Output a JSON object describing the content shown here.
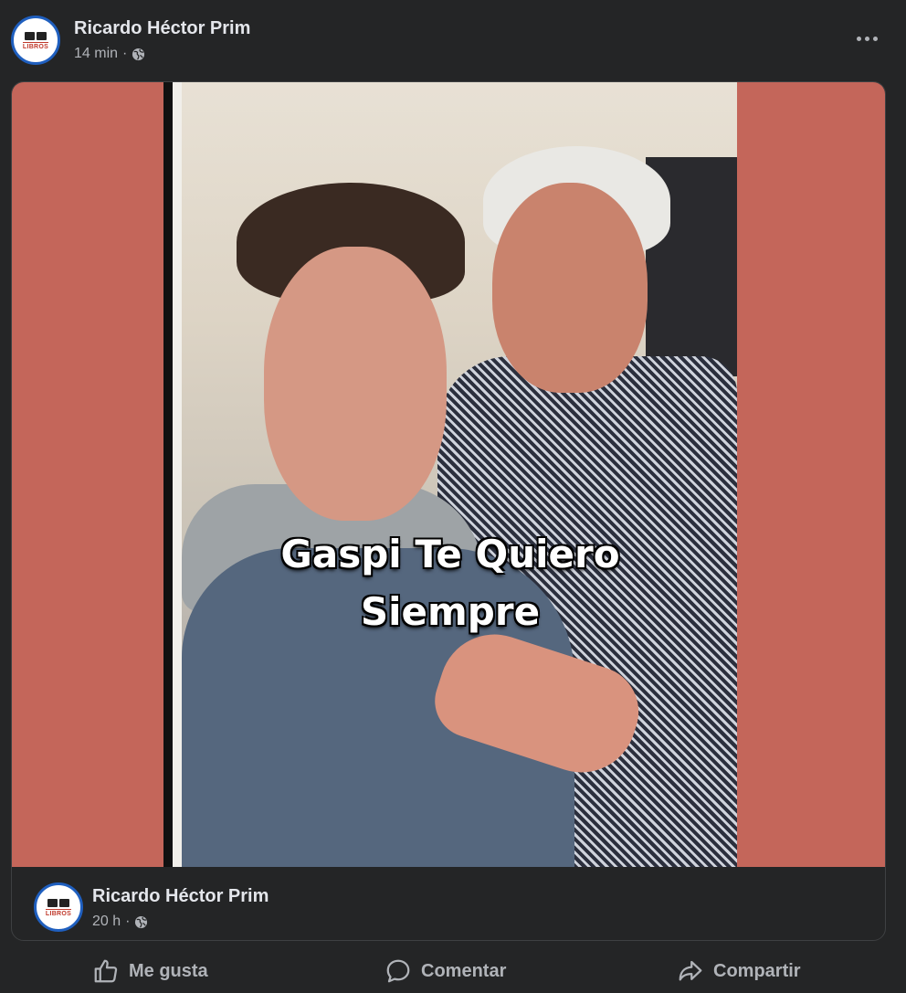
{
  "post": {
    "author": "Ricardo Héctor Prim",
    "time": "14 min",
    "separator": "·",
    "avatar_word": "LIBROS"
  },
  "shared_post": {
    "caption_line1": "Gaspi Te Quiero",
    "caption_line2": "Siempre",
    "author": "Ricardo Héctor Prim",
    "time": "20 h",
    "separator": "·"
  },
  "actions": {
    "like": "Me gusta",
    "comment": "Comentar",
    "share": "Compartir"
  },
  "icons": {
    "privacy": "globe-icon",
    "more": "more-options-icon",
    "like": "thumbs-up-icon",
    "comment": "comment-bubble-icon",
    "share": "share-arrow-icon"
  },
  "colors": {
    "background": "#242526",
    "media_letterbox": "#c4665a",
    "text_primary": "#e4e6eb",
    "text_secondary": "#b0b3b8"
  }
}
